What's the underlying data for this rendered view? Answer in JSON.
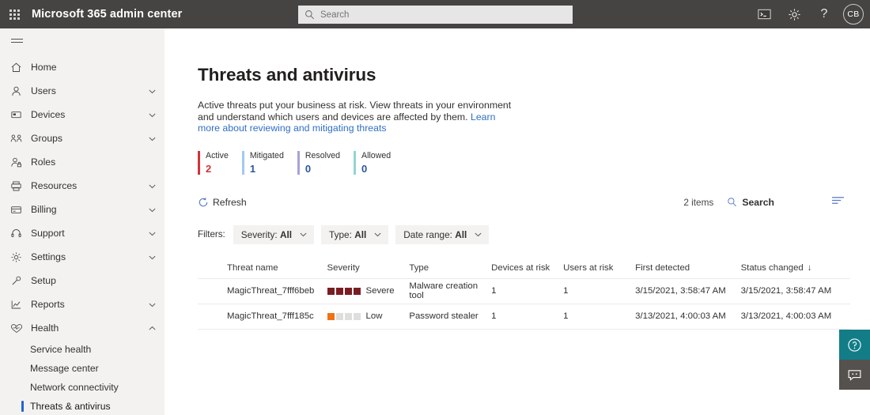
{
  "suitebar": {
    "waffle_icon": "app-launcher-icon",
    "title": "Microsoft 365 admin center",
    "search_placeholder": "Search",
    "search_value": "",
    "search_icon": "search-icon",
    "icons": [
      {
        "name": "console-icon",
        "glyph": "console"
      },
      {
        "name": "gear-icon",
        "glyph": "gear"
      },
      {
        "name": "help-icon",
        "glyph": "?"
      }
    ],
    "avatar_initials": "CB",
    "background": "#464442"
  },
  "sidebar": {
    "hamburger_icon": "hamburger-menu-icon",
    "background": "#f3f2f1",
    "items": [
      {
        "label": "Home",
        "icon": "home-icon",
        "chevron": ""
      },
      {
        "label": "Users",
        "icon": "user-icon",
        "chevron": "down"
      },
      {
        "label": "Devices",
        "icon": "device-icon",
        "chevron": "down"
      },
      {
        "label": "Groups",
        "icon": "groups-icon",
        "chevron": "down"
      },
      {
        "label": "Roles",
        "icon": "roles-icon",
        "chevron": ""
      },
      {
        "label": "Resources",
        "icon": "resources-icon",
        "chevron": "down"
      },
      {
        "label": "Billing",
        "icon": "billing-icon",
        "chevron": "down"
      },
      {
        "label": "Support",
        "icon": "support-icon",
        "chevron": "down"
      },
      {
        "label": "Settings",
        "icon": "settings-gear-icon",
        "chevron": "down"
      },
      {
        "label": "Setup",
        "icon": "setup-wrench-icon",
        "chevron": ""
      },
      {
        "label": "Reports",
        "icon": "reports-chart-icon",
        "chevron": "down"
      },
      {
        "label": "Health",
        "icon": "health-heart-icon",
        "chevron": "up"
      }
    ],
    "sub_items": [
      {
        "label": "Service health",
        "selected": false
      },
      {
        "label": "Message center",
        "selected": false
      },
      {
        "label": "Network connectivity",
        "selected": false
      },
      {
        "label": "Threats & antivirus",
        "selected": true
      }
    ],
    "selected_accent": "#2564cf"
  },
  "main": {
    "title": "Threats and antivirus",
    "description_part1": "Active threats put your business at risk. View threats in your environment and understand which users and devices are affected by them. ",
    "description_link": "Learn more about reviewing and mitigating threats",
    "stats": [
      {
        "label": "Active",
        "value": "2",
        "color": "#d13438"
      },
      {
        "label": "Mitigated",
        "value": "1",
        "color": "#a3c8ee"
      },
      {
        "label": "Resolved",
        "value": "0",
        "color": "#a6a3d6"
      },
      {
        "label": "Allowed",
        "value": "0",
        "color": "#92d5d1"
      }
    ],
    "stat_value_color": "#2b579a",
    "toolbar": {
      "refresh_label": "Refresh",
      "refresh_icon": "refresh-icon",
      "items_count": "2 items",
      "search_label": "Search",
      "search_icon": "search-icon",
      "list_options_icon": "list-options-icon"
    },
    "filters": {
      "label": "Filters:",
      "pills": [
        {
          "name": "Severity:",
          "value": "All"
        },
        {
          "name": "Type:",
          "value": "All"
        },
        {
          "name": "Date range:",
          "value": "All"
        }
      ],
      "chevron_icon": "chevron-down-icon"
    },
    "table": {
      "columns": [
        "Threat name",
        "Severity",
        "Type",
        "Devices at risk",
        "Users at risk",
        "First detected",
        "Status changed"
      ],
      "sorted_column": "Status changed",
      "sort_arrow": "↓",
      "rows": [
        {
          "name": "MagicThreat_7fff6beb",
          "severity_label": "Severe",
          "severity_filled": 4,
          "severity_color": "#7a1d23",
          "type": "Malware creation tool",
          "devices": "1",
          "users": "1",
          "first_detected": "3/15/2021, 3:58:47 AM",
          "status_changed": "3/15/2021, 3:58:47 AM"
        },
        {
          "name": "MagicThreat_7fff185c",
          "severity_label": "Low",
          "severity_filled": 1,
          "severity_color": "#ef7216",
          "type": "Password stealer",
          "devices": "1",
          "users": "1",
          "first_detected": "3/13/2021, 4:00:03 AM",
          "status_changed": "3/13/2021, 4:00:03 AM"
        }
      ],
      "severity_empty_color": "#dededd"
    },
    "fab": {
      "help_icon": "help-circle-icon",
      "help_color": "#127d87",
      "feedback_icon": "feedback-chat-icon",
      "feedback_color": "#54514e"
    }
  }
}
